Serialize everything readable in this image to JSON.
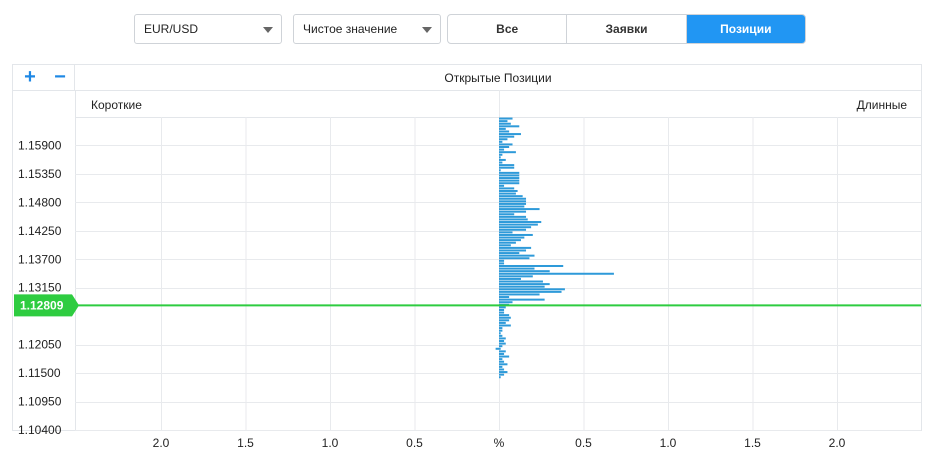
{
  "toolbar": {
    "instrument": "EUR/USD",
    "mode": "Чистое значение",
    "tabs": [
      {
        "label": "Все",
        "active": false
      },
      {
        "label": "Заявки",
        "active": false
      },
      {
        "label": "Позиции",
        "active": true
      }
    ]
  },
  "chart": {
    "zoom_in": "+",
    "zoom_out": "−",
    "title": "Открытые Позиции",
    "left_label": "Короткие",
    "right_label": "Длинные",
    "current_price": "1.12809"
  },
  "colors": {
    "bar": "#2e9ad9",
    "price_line": "#2ecc40",
    "accent": "#2196f3"
  },
  "chart_data": {
    "type": "bar",
    "orientation": "horizontal",
    "title": "Открытые Позиции",
    "left_label": "Короткие",
    "right_label": "Длинные",
    "x_unit": "%",
    "x_ticks": [
      "2.0",
      "1.5",
      "1.0",
      "0.5",
      "%",
      "0.5",
      "1.0",
      "1.5",
      "2.0"
    ],
    "y_ticks": [
      "1.15900",
      "1.15350",
      "1.14800",
      "1.14250",
      "1.13700",
      "1.13150",
      "1.12050",
      "1.11500",
      "1.10950",
      "1.10400"
    ],
    "ylim": [
      1.104,
      1.1645
    ],
    "current_price": 1.12809,
    "bar_step": 0.0005,
    "bar_start": 1.1642,
    "long": [
      0.08,
      0.05,
      0.07,
      0.12,
      0.04,
      0.06,
      0.13,
      0.09,
      0.05,
      0.02,
      0.08,
      0.06,
      0.03,
      0.1,
      0.02,
      0.01,
      0.04,
      0.02,
      0.09,
      0.09,
      0.01,
      0.12,
      0.12,
      0.12,
      0.12,
      0.12,
      0.03,
      0.09,
      0.11,
      0.1,
      0.14,
      0.16,
      0.16,
      0.16,
      0.15,
      0.24,
      0.16,
      0.09,
      0.16,
      0.17,
      0.25,
      0.23,
      0.19,
      0.16,
      0.08,
      0.2,
      0.15,
      0.13,
      0.1,
      0.07,
      0.19,
      0.16,
      0.12,
      0.21,
      0.18,
      0.03,
      0.03,
      0.38,
      0.21,
      0.3,
      0.68,
      0.2,
      0.13,
      0.26,
      0.3,
      0.27,
      0.39,
      0.37,
      0.24,
      0.06,
      0.27,
      0.08,
      0.06,
      0.04,
      0.03,
      0.03,
      0.06,
      0.07,
      0.06,
      0.04,
      0.07,
      0.02,
      0.02,
      0.01,
      0.02,
      0.04,
      0.03,
      0.04,
      0.02,
      0.01,
      0.04,
      0.03,
      0.06,
      0.02,
      0.03,
      0.05,
      0.02,
      0.03,
      0.05,
      0.03,
      0.01
    ],
    "short": [
      0,
      0,
      0,
      0,
      0,
      0,
      0,
      0,
      0,
      0,
      0,
      0,
      0,
      0,
      0,
      0,
      0,
      0,
      0,
      0,
      0,
      0,
      0,
      0,
      0,
      0,
      0,
      0,
      0,
      0,
      0,
      0,
      0,
      0,
      0,
      0,
      0,
      0,
      0,
      0,
      0,
      0,
      0,
      0,
      0,
      0,
      0,
      0,
      0,
      0,
      0,
      0,
      0,
      0,
      0,
      0,
      0,
      0,
      0,
      0,
      0,
      0,
      0,
      0,
      0,
      0,
      0,
      0,
      0,
      0,
      0,
      0,
      0,
      0,
      0,
      0,
      0,
      0,
      0,
      0,
      0,
      0,
      0,
      0,
      0,
      0,
      0,
      0,
      0,
      0.02,
      0,
      0,
      0,
      0,
      0,
      0,
      0,
      0,
      0,
      0,
      0
    ],
    "grid": true
  }
}
